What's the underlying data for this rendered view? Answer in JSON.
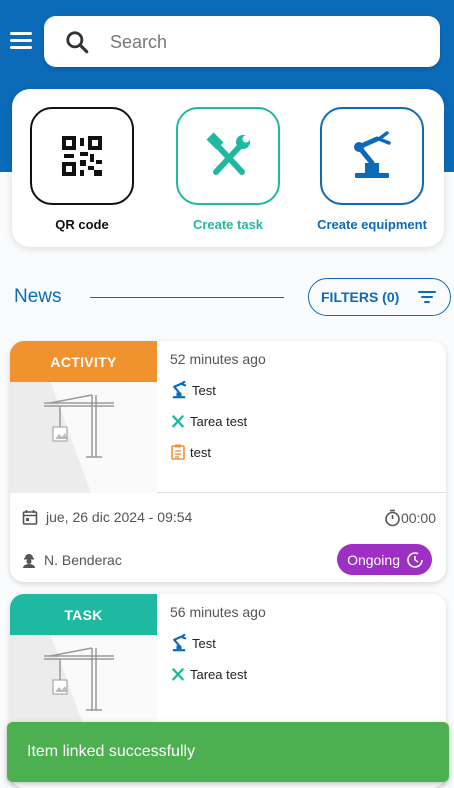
{
  "search": {
    "placeholder": "Search"
  },
  "quick_actions": [
    {
      "label": "QR code",
      "icon": "qr-code-icon"
    },
    {
      "label": "Create task",
      "icon": "tools-icon"
    },
    {
      "label": "Create equipment",
      "icon": "robot-arm-icon"
    }
  ],
  "news": {
    "title": "News",
    "filters_label": "FILTERS (0)"
  },
  "cards": [
    {
      "badge": "ACTIVITY",
      "time_ago": "52 minutes ago",
      "links": [
        {
          "label": "Test",
          "icon": "equipment-icon"
        },
        {
          "label": "Tarea test",
          "icon": "tools-icon"
        },
        {
          "label": "test",
          "icon": "clipboard-icon"
        }
      ],
      "date": "jue, 26 dic 2024 - 09:54",
      "timer": "00:00",
      "user": "N. Benderac",
      "status": "Ongoing"
    },
    {
      "badge": "TASK",
      "time_ago": "56 minutes ago",
      "links": [
        {
          "label": "Test",
          "icon": "equipment-icon"
        },
        {
          "label": "Tarea test",
          "icon": "tools-icon"
        }
      ]
    }
  ],
  "toast": {
    "message": "Item linked successfully"
  },
  "colors": {
    "primary": "#0b6bb8",
    "activity": "#f0932f",
    "task": "#1fb8a0",
    "ongoing": "#9d2fc5",
    "success": "#4caf50"
  }
}
